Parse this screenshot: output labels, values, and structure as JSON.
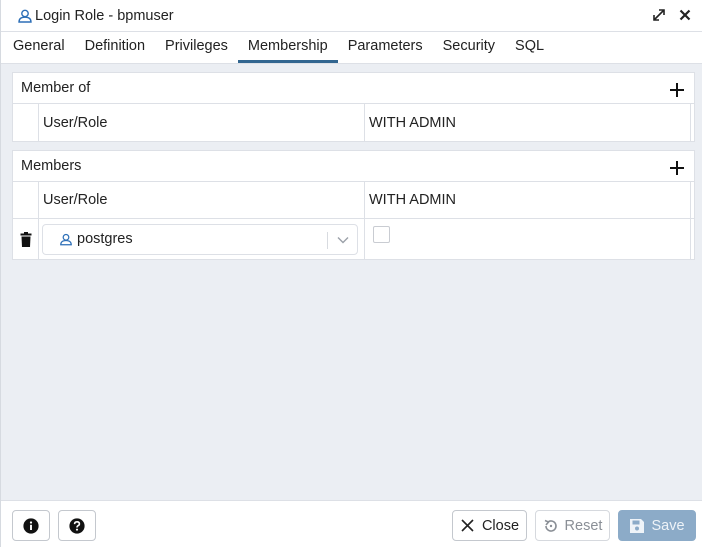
{
  "window": {
    "title": "Login Role - bpmuser",
    "title_icon": "user-role-icon",
    "actions": [
      "maximize-icon",
      "close-icon"
    ]
  },
  "tabs": [
    {
      "label": "General",
      "active": false
    },
    {
      "label": "Definition",
      "active": false
    },
    {
      "label": "Privileges",
      "active": false
    },
    {
      "label": "Membership",
      "active": true
    },
    {
      "label": "Parameters",
      "active": false
    },
    {
      "label": "Security",
      "active": false
    },
    {
      "label": "SQL",
      "active": false
    }
  ],
  "member_of": {
    "header": "Member of",
    "columns": [
      "User/Role",
      "WITH ADMIN"
    ],
    "rows": []
  },
  "members": {
    "header": "Members",
    "columns": [
      "User/Role",
      "WITH ADMIN"
    ],
    "rows": [
      {
        "role": "postgres",
        "with_admin": false
      }
    ]
  },
  "footer": {
    "close_label": "Close",
    "reset_label": "Reset",
    "save_label": "Save"
  },
  "colors": {
    "accent": "#326690",
    "save_bg": "#8cabc8",
    "role_icon": "#2d6fb7"
  }
}
